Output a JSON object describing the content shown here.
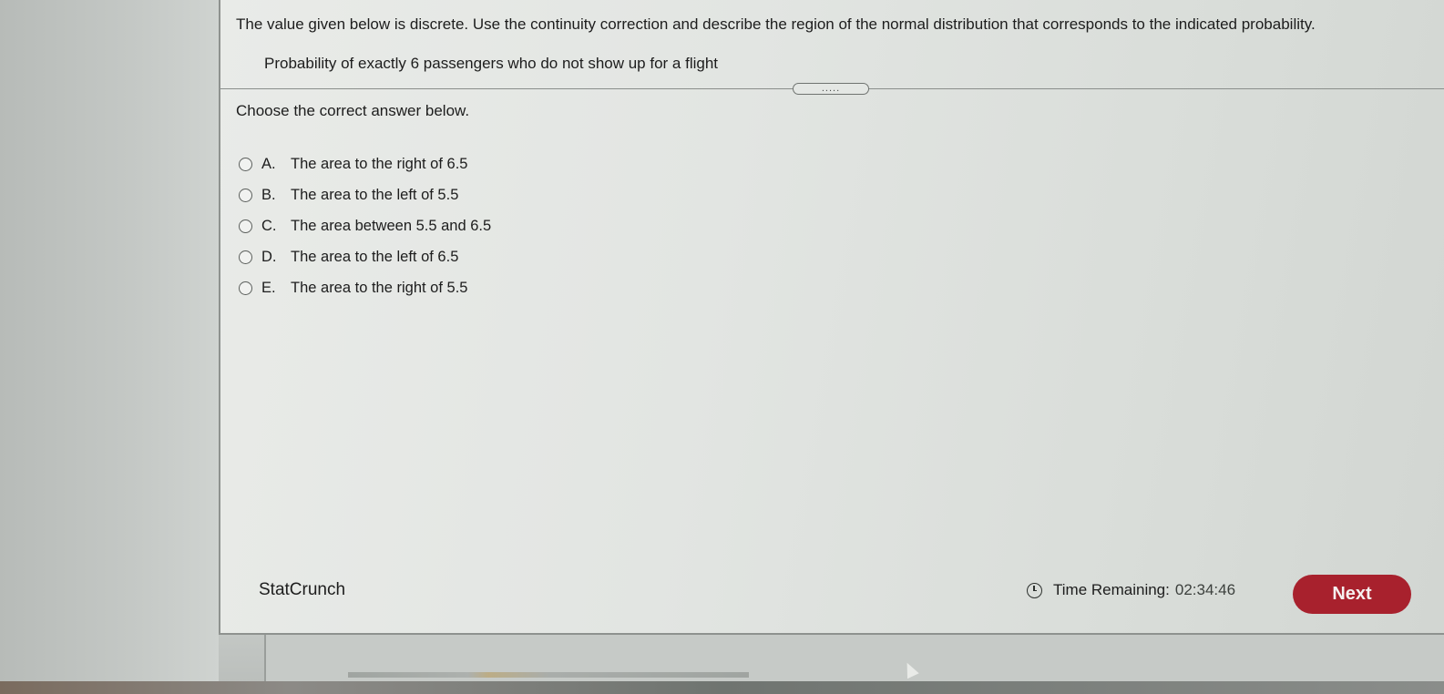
{
  "question": {
    "instruction": "The value given below is discrete. Use the continuity correction and describe the region of the normal distribution that corresponds to the indicated probability.",
    "prompt": "Probability of exactly 6 passengers who do not show up for a flight",
    "more_handle": "....."
  },
  "choose_label": "Choose the correct answer below.",
  "options": [
    {
      "letter": "A.",
      "text": "The area to the right of 6.5"
    },
    {
      "letter": "B.",
      "text": "The area to the left of 5.5"
    },
    {
      "letter": "C.",
      "text": "The area between 5.5 and 6.5"
    },
    {
      "letter": "D.",
      "text": "The area to the left of 6.5"
    },
    {
      "letter": "E.",
      "text": "The area to the right of 5.5"
    }
  ],
  "footer": {
    "statcrunch_label": "StatCrunch",
    "time_label": "Time Remaining:",
    "time_value": "02:34:46",
    "next_label": "Next"
  },
  "colors": {
    "next_button": "#a8212d",
    "panel_background": "#e5e7e4"
  },
  "icons": {
    "timer": "clock-icon",
    "radio": "radio-button"
  }
}
